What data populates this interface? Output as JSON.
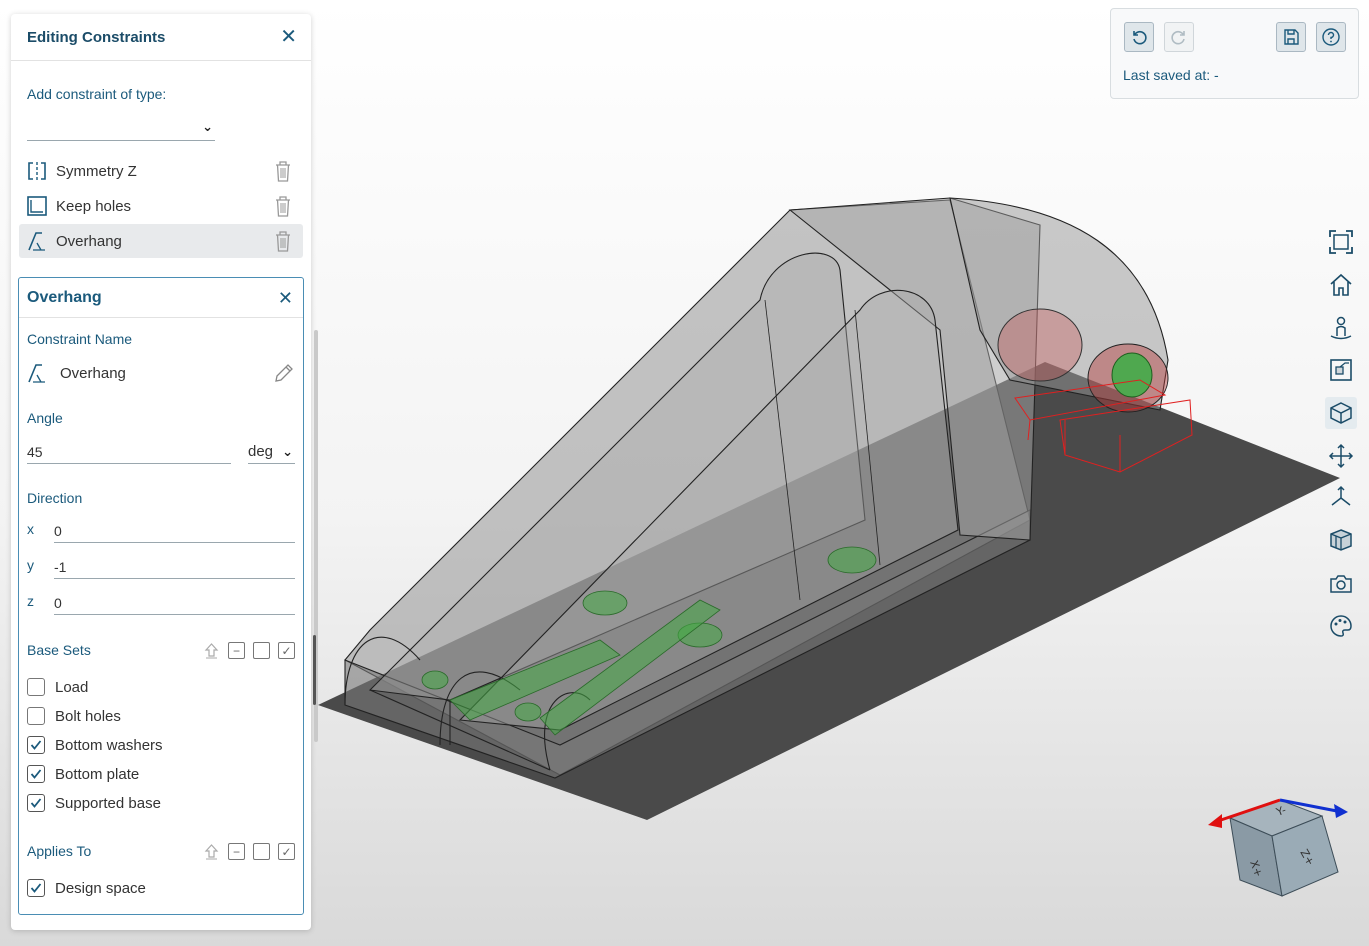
{
  "panel": {
    "title": "Editing Constraints",
    "add_label": "Add constraint of type:",
    "type_value": "",
    "constraints": [
      {
        "label": "Symmetry Z",
        "icon": "symmetry-icon"
      },
      {
        "label": "Keep holes",
        "icon": "keep-holes-icon"
      },
      {
        "label": "Overhang",
        "icon": "overhang-icon",
        "selected": true
      }
    ]
  },
  "detail": {
    "title": "Overhang",
    "name_label": "Constraint Name",
    "name_value": "Overhang",
    "angle_label": "Angle",
    "angle_value": "45",
    "angle_unit": "deg",
    "direction_label": "Direction",
    "x_label": "x",
    "x_value": "0",
    "y_label": "y",
    "y_value": "-1",
    "z_label": "z",
    "z_value": "0",
    "base_sets_label": "Base Sets",
    "base_sets": [
      {
        "label": "Load",
        "checked": false
      },
      {
        "label": "Bolt holes",
        "checked": false
      },
      {
        "label": "Bottom washers",
        "checked": true
      },
      {
        "label": "Bottom plate",
        "checked": true
      },
      {
        "label": "Supported base",
        "checked": true
      }
    ],
    "applies_to_label": "Applies To",
    "applies_to": [
      {
        "label": "Design space",
        "checked": true
      }
    ]
  },
  "save_panel": {
    "last_saved": "Last saved at: -"
  },
  "colors": {
    "accent": "#1b5a7c",
    "plate": "#4d4d4d",
    "highlight_green": "#3aa53a",
    "highlight_red": "#d42020"
  }
}
